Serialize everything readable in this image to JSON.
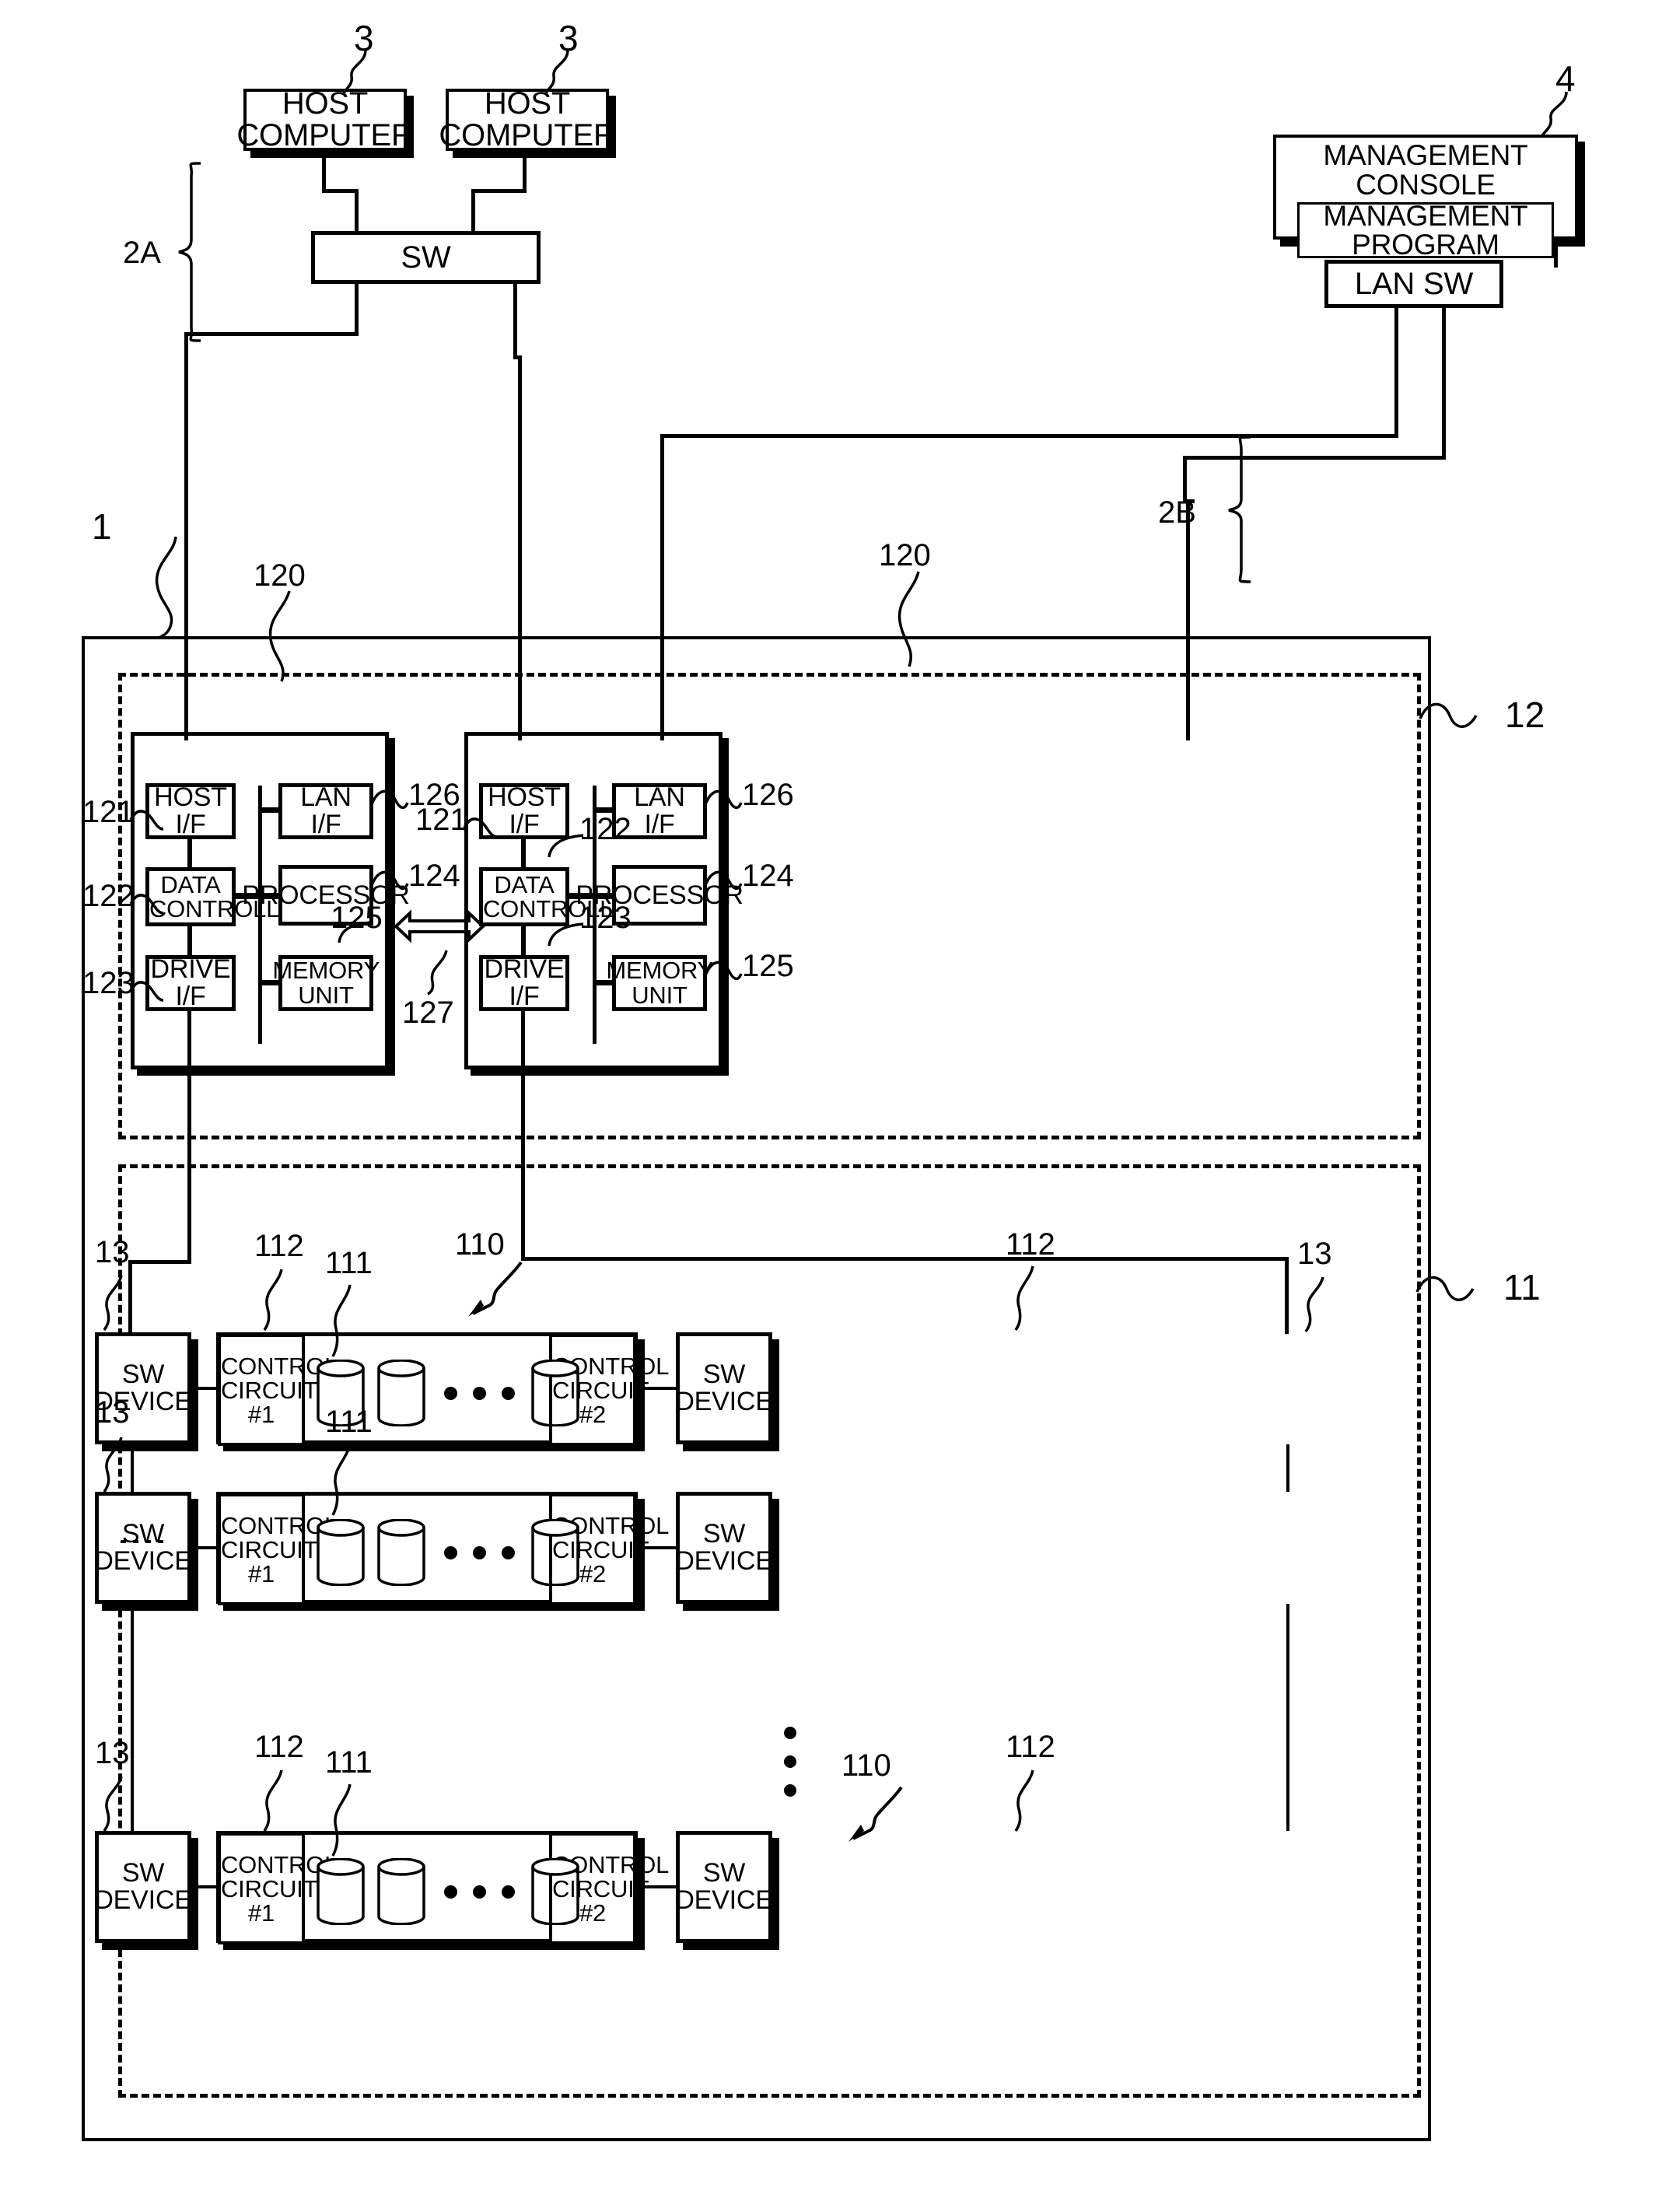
{
  "figure": {
    "type": "patent-block-diagram",
    "title": ""
  },
  "nodes": {
    "host_computer_1": "HOST COMPUTER",
    "host_computer_2": "HOST COMPUTER",
    "sw": "SW",
    "management_console": "MANAGEMENT CONSOLE",
    "management_program": "MANAGEMENT PROGRAM",
    "lan_sw": "LAN SW"
  },
  "controllers": [
    {
      "host_if": "HOST I/F",
      "lan_if": "LAN I/F",
      "data_controller": "DATA CONTROLLER",
      "processor": "PROCESSOR",
      "drive_if": "DRIVE I/F",
      "memory_unit": "MEMORY UNIT"
    },
    {
      "host_if": "HOST I/F",
      "lan_if": "LAN I/F",
      "data_controller": "DATA CONTROLLER",
      "processor": "PROCESSOR",
      "drive_if": "DRIVE I/F",
      "memory_unit": "MEMORY UNIT"
    }
  ],
  "drive_rows": [
    {
      "sw_device_left": "SW DEVICE",
      "control_circuit_1": "CONTROL CIRCUIT #1",
      "control_circuit_2": "CONTROL CIRCUIT #2",
      "sw_device_right": "SW DEVICE",
      "disk_count_visible": 3
    },
    {
      "sw_device_left": "SW DEVICE",
      "control_circuit_1": "CONTROL CIRCUIT #1",
      "control_circuit_2": "CONTROL CIRCUIT #2",
      "sw_device_right": "SW DEVICE",
      "disk_count_visible": 3
    },
    {
      "sw_device_left": "SW DEVICE",
      "control_circuit_1": "CONTROL CIRCUIT #1",
      "control_circuit_2": "CONTROL CIRCUIT #2",
      "sw_device_right": "SW DEVICE",
      "disk_count_visible": 3
    }
  ],
  "reference_numerals": {
    "host_1": "3",
    "host_2": "3",
    "mgmt_console": "4",
    "network_2a": "2A",
    "network_2b": "2B",
    "storage_system": "1",
    "controller_enclosure": "12",
    "drive_enclosure": "11",
    "path_120_a": "120",
    "path_120_b": "120",
    "host_if_left": "121",
    "host_if_right": "121",
    "data_controller_left": "122",
    "data_controller_right": "122",
    "drive_if_left": "123",
    "drive_if_right": "123",
    "processor_left": "124",
    "processor_right": "124",
    "memory_left": "125",
    "memory_right": "125",
    "lan_if_left": "126",
    "lan_if_right": "126",
    "interconnect_127": "127",
    "sw_device_r1l": "13",
    "sw_device_r1r": "13",
    "sw_device_r2l": "13",
    "sw_device_r3l": "13",
    "control_circuit_r1l": "112",
    "control_circuit_r1r": "112",
    "control_circuit_r3l": "112",
    "control_circuit_r3r": "112",
    "disk_r1": "111",
    "disk_r2": "111",
    "disk_r3": "111",
    "drive_unit_r1": "110",
    "drive_unit_r3": "110"
  },
  "colors": {
    "ink": "#000000",
    "paper": "#ffffff"
  }
}
